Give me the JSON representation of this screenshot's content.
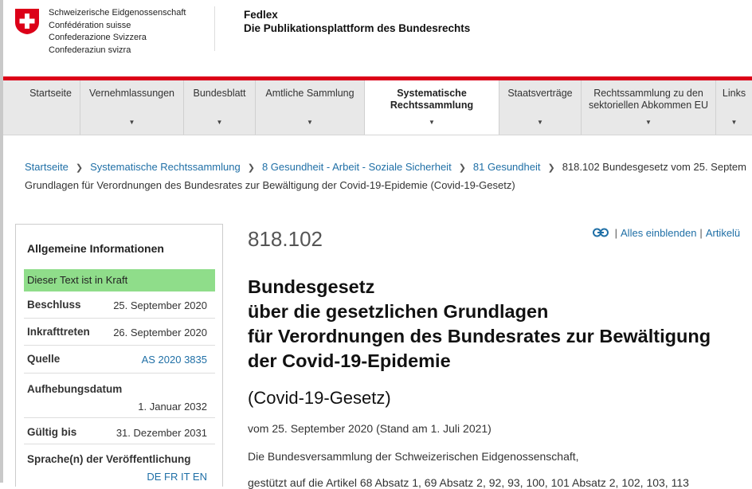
{
  "header": {
    "confederation": [
      "Schweizerische Eidgenossenschaft",
      "Confédération suisse",
      "Confederazione Svizzera",
      "Confederaziun svizra"
    ],
    "site_name": "Fedlex",
    "site_subtitle": "Die Publikationsplattform des Bundesrechts"
  },
  "nav": {
    "items": [
      {
        "label": "Startseite"
      },
      {
        "label": "Vernehmlassungen"
      },
      {
        "label": "Bundesblatt"
      },
      {
        "label": "Amtliche Sammlung"
      },
      {
        "label": "Systematische Rechtssammlung"
      },
      {
        "label": "Staatsverträge"
      },
      {
        "label": "Rechtssammlung zu den sektoriellen Abkommen EU"
      },
      {
        "label": "Links"
      }
    ]
  },
  "breadcrumb": {
    "items": [
      "Startseite",
      "Systematische Rechtssammlung",
      "8 Gesundheit - Arbeit - Soziale Sicherheit",
      "81 Gesundheit"
    ],
    "current_line1": "818.102 Bundesgesetz vom 25. Septem",
    "current_line2": "Grundlagen für Verordnungen des Bundesrates zur Bewältigung der Covid-19-Epidemie (Covid-19-Gesetz)"
  },
  "sidebar": {
    "title": "Allgemeine Informationen",
    "status": "Dieser Text ist in Kraft",
    "rows": [
      {
        "label": "Beschluss",
        "value": "25. September 2020"
      },
      {
        "label": "Inkrafttreten",
        "value": "26. September 2020"
      },
      {
        "label": "Quelle",
        "value": "AS 2020 3835"
      },
      {
        "label": "Aufhebungsdatum",
        "value": "1. Januar 2032"
      },
      {
        "label": "Gültig bis",
        "value": "31. Dezember 2031"
      },
      {
        "label": "Sprache(n) der Veröffentlichung",
        "value": "DE FR IT EN"
      }
    ]
  },
  "main": {
    "sr_number": "818.102",
    "tools": {
      "show_all": "Alles einblenden",
      "articles": "Artikelü"
    },
    "title_lines": [
      "Bundesgesetz",
      "über die gesetzlichen Grundlagen",
      "für Verordnungen des Bundesrates zur Bewältigung",
      "der Covid-19-Epidemie"
    ],
    "short_title": "(Covid-19-Gesetz)",
    "date_line": "vom 25. September 2020 (Stand am 1. Juli 2021)",
    "preamble": "Die Bundesversammlung der Schweizerischen Eidgenossenschaft,",
    "preamble2": "gestützt auf die Artikel 68 Absatz 1, 69 Absatz 2, 92, 93, 100, 101 Absatz 2, 102, 103, 113"
  },
  "colors": {
    "accent_red": "#dc0018",
    "link_blue": "#1f6fa6",
    "status_green": "#8fdd8a"
  }
}
